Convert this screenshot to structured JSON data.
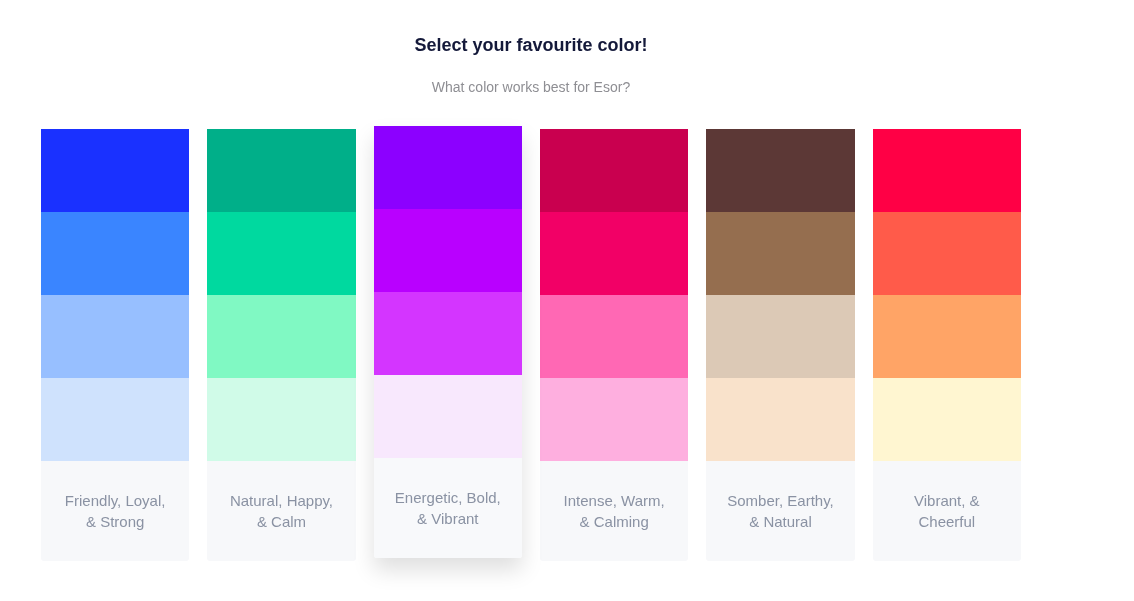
{
  "header": {
    "title": "Select your favourite color!",
    "subtitle": "What color works best for Esor?"
  },
  "palettes": [
    {
      "selected": false,
      "label_lines": [
        "Friendly, Loyal,",
        "& Strong"
      ],
      "swatches": [
        {
          "color": "#1a31ff"
        },
        {
          "color": "#3a85ff"
        },
        {
          "color": "#97bfff"
        },
        {
          "color": "#cfe2fd"
        }
      ]
    },
    {
      "selected": false,
      "label_lines": [
        "Natural, Happy,",
        "& Calm"
      ],
      "swatches": [
        {
          "color": "#00af89"
        },
        {
          "color": "#00d99f"
        },
        {
          "color": "#80f9c3"
        },
        {
          "color": "#d0fbe8"
        }
      ]
    },
    {
      "selected": true,
      "label_lines": [
        "Energetic, Bold,",
        "& Vibrant"
      ],
      "swatches": [
        {
          "color": "#8c00ff"
        },
        {
          "color": "#b900ff"
        },
        {
          "color": "#d435ff"
        },
        {
          "color": "#f8e8fd"
        }
      ]
    },
    {
      "selected": false,
      "label_lines": [
        "Intense, Warm,",
        "& Calming"
      ],
      "swatches": [
        {
          "color": "#c9004f"
        },
        {
          "color": "#f20066"
        },
        {
          "color": "#ff68b4"
        },
        {
          "color": "#feafdf"
        }
      ]
    },
    {
      "selected": false,
      "label_lines": [
        "Somber, Earthy,",
        "& Natural"
      ],
      "swatches": [
        {
          "color": "#5c3836"
        },
        {
          "color": "#956e4f"
        },
        {
          "color": "#dcc9b6"
        },
        {
          "color": "#f9e2cb"
        }
      ]
    },
    {
      "selected": false,
      "label_lines": [
        "Vibrant, &",
        "Cheerful"
      ],
      "swatches": [
        {
          "color": "#ff0045"
        },
        {
          "color": "#ff5b4a"
        },
        {
          "color": "#ffa466"
        },
        {
          "color": "#fff6d1"
        }
      ]
    }
  ]
}
